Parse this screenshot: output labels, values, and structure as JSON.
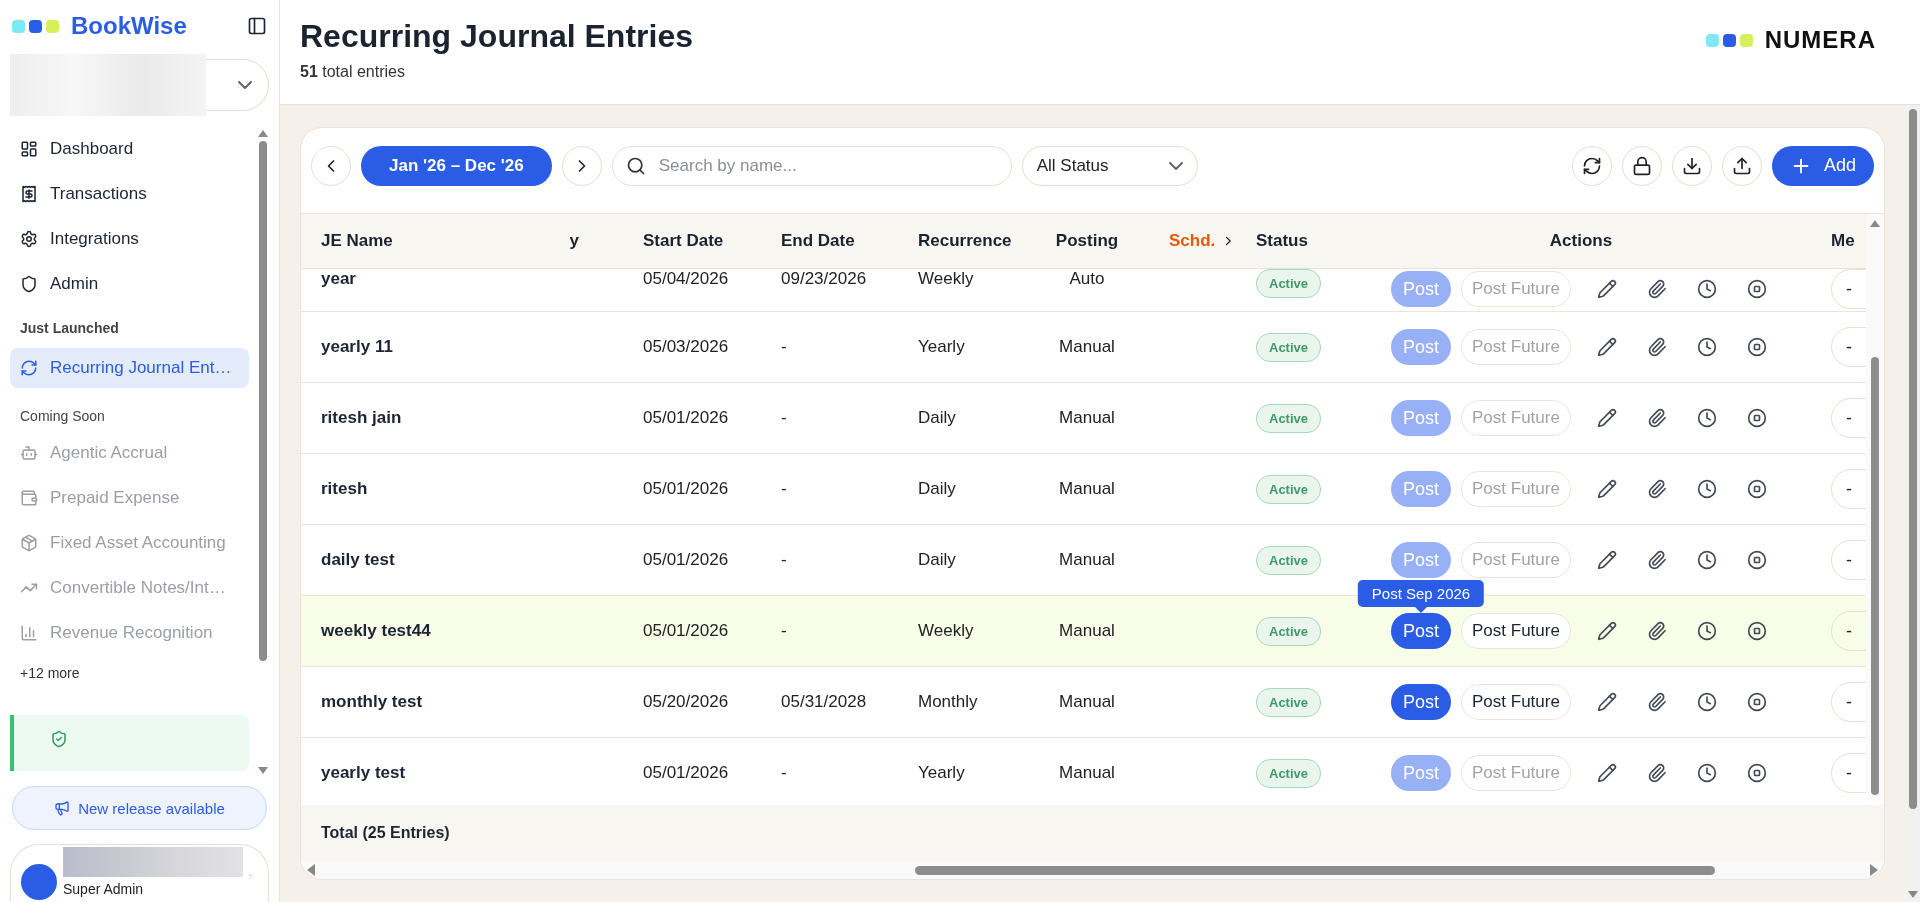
{
  "sidebar": {
    "brand": "BookWise",
    "sections": [
      {
        "items": [
          {
            "label": "Dashboard",
            "selected": false,
            "disabled": false
          },
          {
            "label": "Transactions",
            "selected": false,
            "disabled": false
          },
          {
            "label": "Integrations",
            "selected": false,
            "disabled": false
          },
          {
            "label": "Admin",
            "selected": false,
            "disabled": false
          }
        ]
      },
      {
        "heading": "Just Launched",
        "items": [
          {
            "label": "Recurring Journal Ent…",
            "selected": true,
            "disabled": false
          }
        ]
      },
      {
        "heading": "Coming Soon",
        "items": [
          {
            "label": "Agentic Accrual",
            "selected": false,
            "disabled": true
          },
          {
            "label": "Prepaid Expense",
            "selected": false,
            "disabled": true
          },
          {
            "label": "Fixed Asset Accounting",
            "selected": false,
            "disabled": true
          },
          {
            "label": "Convertible Notes/Int…",
            "selected": false,
            "disabled": true
          },
          {
            "label": "Revenue Recognition",
            "selected": false,
            "disabled": true
          }
        ]
      }
    ],
    "more": "+12 more",
    "release_button": "New release available",
    "user": {
      "role": "Super Admin"
    }
  },
  "header": {
    "title": "Recurring Journal Entries",
    "subtitle": "**51** total entries",
    "logo": "NUMERA"
  },
  "toolbar": {
    "date_range": "Jan '26 – Dec '26",
    "search": {
      "placeholder": "Search by name..."
    },
    "status_filter": "All Status",
    "add_button": "Add"
  },
  "table": {
    "columns": [
      "JE Name",
      "y",
      "Start Date",
      "End Date",
      "Recurrence",
      "Posting",
      "Schd.",
      "Status",
      "Actions",
      "Me"
    ],
    "rows": [
      {
        "name": "year",
        "start": "05/04/2026",
        "end": "09/23/2026",
        "recurrence": "Weekly",
        "posting": "Auto",
        "status": "Active",
        "post": {
          "label": "Post",
          "disabled": true
        },
        "post_future": {
          "label": "Post Future",
          "disabled": true
        },
        "mem": "-",
        "selected": false
      },
      {
        "name": "yearly 11",
        "start": "05/03/2026",
        "end": "-",
        "recurrence": "Yearly",
        "posting": "Manual",
        "status": "Active",
        "post": {
          "label": "Post",
          "disabled": true
        },
        "post_future": {
          "label": "Post Future",
          "disabled": true
        },
        "mem": "-",
        "selected": false
      },
      {
        "name": "ritesh jain",
        "start": "05/01/2026",
        "end": "-",
        "recurrence": "Daily",
        "posting": "Manual",
        "status": "Active",
        "post": {
          "label": "Post",
          "disabled": true
        },
        "post_future": {
          "label": "Post Future",
          "disabled": true
        },
        "mem": "-",
        "selected": false
      },
      {
        "name": "ritesh",
        "start": "05/01/2026",
        "end": "-",
        "recurrence": "Daily",
        "posting": "Manual",
        "status": "Active",
        "post": {
          "label": "Post",
          "disabled": true
        },
        "post_future": {
          "label": "Post Future",
          "disabled": true
        },
        "mem": "-",
        "selected": false
      },
      {
        "name": "daily test",
        "start": "05/01/2026",
        "end": "-",
        "recurrence": "Daily",
        "posting": "Manual",
        "status": "Active",
        "post": {
          "label": "Post",
          "disabled": true
        },
        "post_future": {
          "label": "Post Future",
          "disabled": true
        },
        "mem": "-",
        "selected": false
      },
      {
        "name": "weekly test44",
        "start": "05/01/2026",
        "end": "-",
        "recurrence": "Weekly",
        "posting": "Manual",
        "status": "Active",
        "post": {
          "label": "Post",
          "disabled": false
        },
        "post_future": {
          "label": "Post Future",
          "disabled": false
        },
        "mem": "-",
        "selected": true,
        "tooltip": "Post Sep 2026"
      },
      {
        "name": "monthly test",
        "start": "05/20/2026",
        "end": "05/31/2028",
        "recurrence": "Monthly",
        "posting": "Manual",
        "status": "Active",
        "post": {
          "label": "Post",
          "disabled": false
        },
        "post_future": {
          "label": "Post Future",
          "disabled": false
        },
        "mem": "-",
        "selected": false
      },
      {
        "name": "yearly test",
        "start": "05/01/2026",
        "end": "-",
        "recurrence": "Yearly",
        "posting": "Manual",
        "status": "Active",
        "post": {
          "label": "Post",
          "disabled": true
        },
        "post_future": {
          "label": "Post Future",
          "disabled": true
        },
        "mem": "-",
        "selected": false
      }
    ],
    "footer": "Total (25 Entries)"
  }
}
